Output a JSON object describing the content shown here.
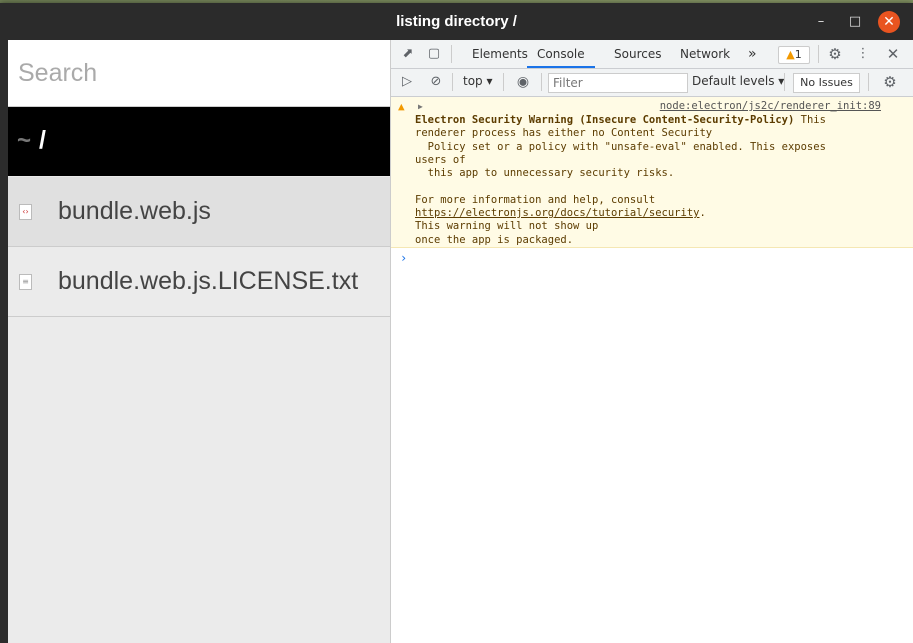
{
  "window": {
    "title": "listing directory /"
  },
  "app": {
    "search_placeholder": "Search",
    "path_home": "~",
    "path_current": "/",
    "files": [
      {
        "name": "bundle.web.js",
        "icon": "js-file-icon"
      },
      {
        "name": "bundle.web.js.LICENSE.txt",
        "icon": "text-file-icon"
      }
    ]
  },
  "devtools": {
    "tabs": [
      "Elements",
      "Console",
      "Sources",
      "Network"
    ],
    "active_tab": "Console",
    "more_tabs": "»",
    "warning_count": "1",
    "context": "top",
    "filter_placeholder": "Filter",
    "levels": "Default levels",
    "no_issues": "No Issues",
    "message": {
      "source": "node:electron/js2c/renderer_init:89",
      "title": "Electron Security Warning (Insecure Content-Security-Policy)",
      "line1_rest": " This",
      "line2": "renderer process has either no Content Security",
      "line3": "  Policy set or a policy with \"unsafe-eval\" enabled. This exposes",
      "line4": "users of",
      "line5": "  this app to unnecessary security risks.",
      "line6": "For more information and help, consult",
      "link": "https://electronjs.org/docs/tutorial/security",
      "link_after": ".",
      "line8": "This warning will not show up",
      "line9": "once the app is packaged."
    }
  },
  "colors": {
    "accent": "#1a73e8",
    "warning": "#f29900",
    "close": "#e95420"
  }
}
